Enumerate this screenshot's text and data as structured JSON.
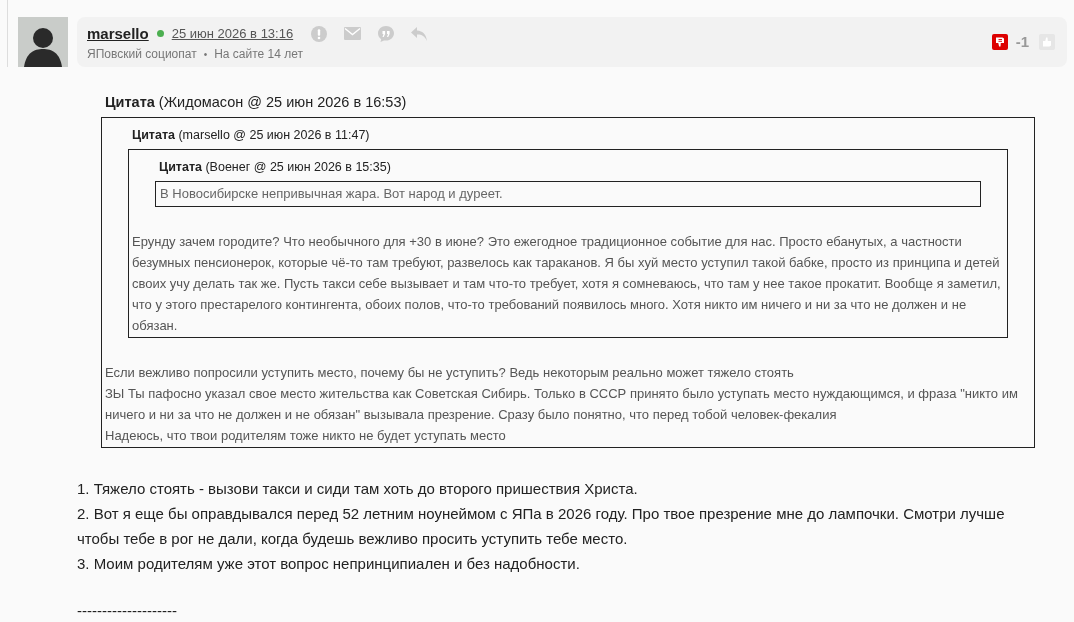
{
  "post": {
    "author": {
      "name": "marsello",
      "online": true
    },
    "date": "25 июн 2026 в 13:16",
    "rank": "ЯПовский социопат",
    "separator": "•",
    "tenure": "На сайте 14 лет",
    "rating": {
      "score": "-1",
      "downvoted": true,
      "upvoted": false
    }
  },
  "quote": {
    "header": "**Цитата** (Жидомасон @ 25 июн 2026 в 16:53)",
    "quote": {
      "header": "**Цитата** (marsello @ 25 июн 2026 в 11:47)",
      "quote": {
        "header": "**Цитата** (Военег @ 25 июн 2026 в 15:35)",
        "paragraphs": [
          "В Новосибирске непривычная жара. Вот народ и дуреет."
        ]
      },
      "paragraphs": [
        "Ерунду зачем городите? Что необычного для +30 в июне? Это ежегодное традиционное событие для нас. Просто ебанутых, а частности безумных пенсионерок, которые чё-то там требуют, развелось как тараканов. Я бы хуй место уступил такой бабке, просто из принципа и детей своих учу делать так же. Пусть такси себе вызывает и там что-то требует, хотя я сомневаюсь, что там у нее такое прокатит. Вообще я заметил, что у этого престарелого контингента, обоих полов, что-то требований появилось много. Хотя никто им ничего и ни за что не должен и не обязан."
      ]
    },
    "paragraphs": [
      "Если вежливо попросили уступить место, почему бы не уступить? Ведь некоторым реально может тяжело стоять",
      "ЗЫ Ты пафосно указал свое место жительства как Советская Сибирь. Только в СССР принято было уступать место нуждающимся, и фраза \"никто им ничего и ни за что не должен и не обязан\" вызывала презрение. Сразу было понятно, что перед тобой человек-фекалия",
      "Надеюсь, что твои родителям тоже никто не будет уступать место"
    ]
  },
  "body": {
    "paragraphs": [
      "1. Тяжело стоять - вызови такси и сиди там хоть до второго пришествия Христа.",
      "2. Вот я еще бы оправдывался перед 52 летним ноунеймом с ЯПа в 2026 году. Про твое презрение мне до лампочки. Смотри лучше чтобы тебе в рог не дали, когда будешь вежливо просить уступить тебе место.",
      "3. Моим родителям уже этот вопрос непринципиален и без надобности."
    ],
    "signature": "--------------------"
  }
}
